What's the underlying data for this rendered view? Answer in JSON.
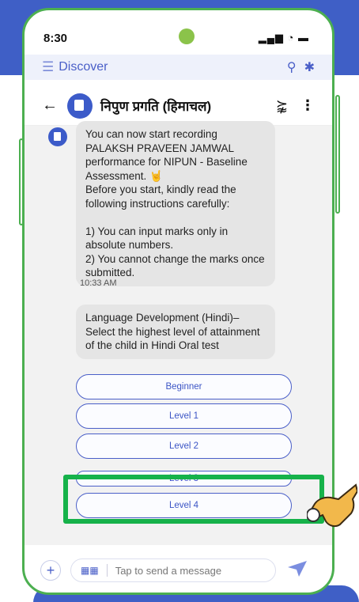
{
  "status_bar": {
    "time": "8:30",
    "icons": "▂▄▆ ◔ ▬"
  },
  "top_bar": {
    "title": "Discover",
    "menu_icon": "hamburger-icon",
    "search_icon": "search-icon",
    "notification_icon": "bell-icon"
  },
  "chat_header": {
    "title": "निपुण प्रगति (हिमाचल)",
    "back_icon": "back-arrow-icon",
    "share_icon": "share-icon",
    "more_icon": "more-vert-icon"
  },
  "messages": [
    {
      "text": "You can now start recording PALAKSH PRAVEEN JAMWAL performance for NIPUN - Baseline Assessment. 🤘\nBefore you start, kindly read the following instructions carefully:\n\n1) You can input marks only in absolute numbers.\n2) You cannot change the marks once submitted.",
      "time": "10:33 AM"
    },
    {
      "text": "Language Development (Hindi)– Select the highest level of attainment of the child in Hindi Oral test"
    }
  ],
  "options": [
    "Beginner",
    "Level 1",
    "Level 2",
    "Level 3",
    "Level 4"
  ],
  "input": {
    "placeholder": "Tap to send a message"
  },
  "colors": {
    "accent": "#3f5fc6",
    "highlight": "#16b24a",
    "phone_border": "#4caf50"
  }
}
